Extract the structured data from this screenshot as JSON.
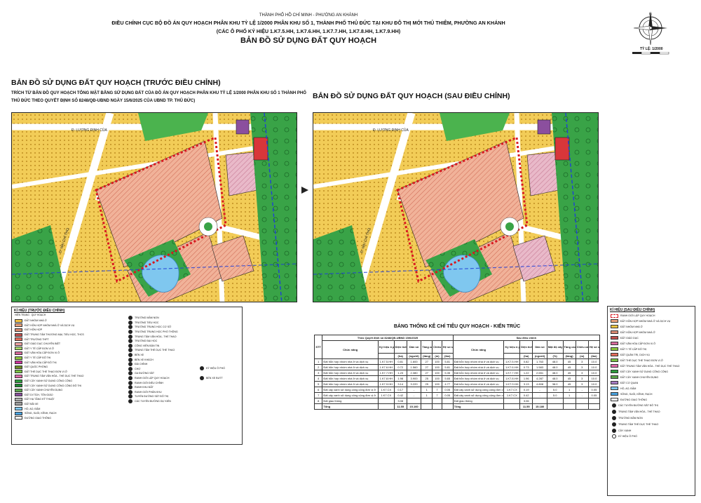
{
  "header": {
    "authority": "THÀNH PHỐ HỒ CHÍ MINH - PHƯỜNG AN KHÁNH",
    "line1": "ĐIỀU CHỈNH CỤC BỘ ĐỒ ÁN QUY HOẠCH PHÂN KHU TỶ LỆ 1/2000 PHÂN KHU SỐ 1, THÀNH PHỐ THỦ ĐỨC TẠI KHU ĐÔ THỊ MỚI THỦ THIÊM, PHƯỜNG AN KHÁNH",
    "line2": "(CÁC Ô PHỐ KÝ HIỆU 1.K7.5.HH, 1.K7.6.HH, 1.K7.7.HH, 1.K7.8.HH, 1.K7.9.HH)",
    "main_title": "BẢN ĐỒ SỬ DỤNG ĐẤT QUY HOẠCH"
  },
  "scale": {
    "label": "TỶ LỆ: 1/2000"
  },
  "left_panel": {
    "title": "BẢN ĐỒ SỬ DỤNG ĐẤT QUY HOẠCH (TRƯỚC ĐIỀU CHỈNH)",
    "subtitle1": "TRÍCH TỪ BẢN ĐỒ QUY HOẠCH TỔNG MẶT BẰNG SỬ DỤNG ĐẤT CỦA ĐỒ ÁN QUY HOẠCH PHÂN KHU TỶ LỆ 1/2000 PHÂN KHU SỐ 1 THÀNH PHỐ",
    "subtitle2": "THỦ ĐỨC THEO QUYẾT ĐỊNH SỐ 8248/QĐ-UBND NGÀY 15/6/2025 CỦA UBND TP. THỦ ĐỨC)"
  },
  "right_panel": {
    "title": "BẢN ĐỒ SỬ DỤNG ĐẤT QUY HOẠCH (SAU ĐIỀU CHỈNH)"
  },
  "legend_left": {
    "title": "KÍ HIỆU (TRƯỚC ĐIỀU CHỈNH)",
    "header_a": "HIỆN TRẠNG",
    "header_b": "QUY HOẠCH",
    "col1": [
      {
        "label": "ĐẤT NHÓM NHÀ Ở",
        "color": "#f4c542"
      },
      {
        "label": "ĐẤT HỖN HỢP NHÓM NHÀ Ở VÀ DỊCH VỤ",
        "color": "#e8a07c"
      },
      {
        "label": "ĐẤT HỖN HỢP",
        "color": "#d98a72"
      },
      {
        "label": "ĐẤT TRUNG TÂM THƯƠNG MẠI, TIỂU HỌC, THCS",
        "color": "#c0504d"
      },
      {
        "label": "ĐẤT TRƯỜNG THPT",
        "color": "#e46c5b"
      },
      {
        "label": "ĐẤT GIÁO DỤC CHUYÊN BIỆT",
        "color": "#f2a2a2"
      },
      {
        "label": "ĐẤT Y TẾ CẤP ĐƠN VỊ Ở",
        "color": "#a5d66a"
      },
      {
        "label": "ĐẤT VĂN HÓA CẤP ĐƠN VỊ Ở",
        "color": "#d86a9c"
      },
      {
        "label": "ĐẤT Y TẾ CẤP ĐÔ THỊ",
        "color": "#8cc63f"
      },
      {
        "label": "ĐẤT VĂN HÓA CẤP ĐÔ THỊ",
        "color": "#cc3399"
      },
      {
        "label": "ĐẤT QUỐC PHÒNG",
        "color": "#6b8e23"
      },
      {
        "label": "ĐẤT THỂ DỤC THỂ THAO ĐƠN VỊ Ở",
        "color": "#7ac143"
      },
      {
        "label": "ĐẤT TRUNG TÂM VĂN HÓA - THỂ DỤC THỂ THAO",
        "color": "#e26aa8"
      },
      {
        "label": "ĐẤT CÂY XANH SỬ DỤNG CÔNG CỘNG",
        "color": "#2e9e3e"
      },
      {
        "label": "ĐẤT CÂY XANH SỬ DỤNG CÔNG CỘNG ĐÔ THỊ",
        "color": "#1e8a32"
      },
      {
        "label": "ĐẤT CÂY XANH CHUYÊN DỤNG",
        "color": "#5aa64a"
      },
      {
        "label": "ĐẤT DI TÍCH, TÔN GIÁO",
        "color": "#8b4f9e"
      },
      {
        "label": "ĐẤT HẠ TẦNG KỸ THUẬT",
        "color": "#b0b0b0"
      },
      {
        "label": "ĐẤT BÃI XE",
        "color": "#9e9e9e"
      },
      {
        "label": "HỒ, AO, ĐẦM",
        "color": "#7fc7ef"
      },
      {
        "label": "SÔNG, SUỐI, KÊNH, RẠCH",
        "color": "#4aa3df"
      },
      {
        "label": "ĐƯỜNG GIAO THÔNG",
        "color": "#ffffff"
      }
    ],
    "col2": [
      "TRƯỜNG MẦM NON",
      "TRƯỜNG TIỂU HỌC",
      "TRƯỜNG TRUNG HỌC CƠ SỞ",
      "TRƯỜNG TRUNG HỌC PHỔ THÔNG",
      "TRUNG TÂM VĂN HÓA - THỂ THAO",
      "TRƯỜNG ĐẠI HỌC",
      "CÔNG VIÊN BẢN TIN",
      "TRUNG TÂM THỂ DỤC THỂ THAO",
      "BẾN XE",
      "BẾN XE KHÁCH",
      "ĐÀI CHỈNH",
      "CHỢ",
      "GA ĐƯỜNG SẮT",
      "RANH GIỚI LẬP QUY HOẠCH",
      "RANH GIỚI ĐIỀU CHỈNH",
      "RANH KHU ĐẤT",
      "RANH GIỚI PHÂN KHU",
      "TUYẾN ĐƯỜNG SẮT ĐÔ THỊ",
      "CÁC TUYẾN ĐƯỜNG DỰ KIẾN"
    ],
    "col3": [
      "KÝ HIỆU Ô PHỐ",
      "BẾN XE BUÝT"
    ]
  },
  "table": {
    "title": "BẢNG THỐNG KÊ CHỈ TIÊU QUY HOẠCH - KIẾN TRÚC",
    "group_before": "Theo Quyết định số 8248/QĐ-UBND 15/6/2025",
    "group_after": "Sau điều chỉnh",
    "headers": {
      "stt": "STT",
      "name": "Chức năng",
      "code": "Ký hiệu ô phố",
      "area": "Diện tích",
      "pop": "Dân số",
      "floors": "Tầng cao tối đa",
      "height": "Chiều cao",
      "far": "Hệ số sử dụng đất",
      "density": "Mật độ xây dựng tối đa",
      "unit_area": "(ha)",
      "unit_pop": "(người)",
      "unit_floor": "(tầng)",
      "unit_h": "(m)",
      "unit_pct": "(%)",
      "unit_far": "(lần)"
    },
    "rows": [
      {
        "stt": "1",
        "name": "Đất hỗn hợp nhóm nhà ở và dịch vụ",
        "code_b": "1.K7.5.HH",
        "area_b": "0.81",
        "pop_b": "1.600",
        "fl_b": "27",
        "h_b": "100",
        "far_b": "5.81",
        "name_a": "Đất hỗn hợp nhóm nhà ở và dịch vụ",
        "code_a": "1.K7.5.HH",
        "area_a": "0.82",
        "pop_a": "1.763",
        "den_a": "48.0",
        "fl_a": "45",
        "fl2_a": "3",
        "far_a": "10.0"
      },
      {
        "stt": "2",
        "name": "Đất hỗn hợp nhóm nhà ở và dịch vụ",
        "code_b": "1.K7.6.HH",
        "area_b": "0.72",
        "pop_b": "1.560",
        "fl_b": "27",
        "h_b": "100",
        "far_b": "5.81",
        "name_a": "Đất hỗn hợp nhóm nhà ở và dịch vụ",
        "code_a": "1.K7.6.HH",
        "area_a": "0.73",
        "pop_a": "1.583",
        "den_a": "48.0",
        "fl_a": "45",
        "fl2_a": "3",
        "far_a": "10.0"
      },
      {
        "stt": "3",
        "name": "Đất hỗn hợp nhóm nhà ở và dịch vụ",
        "code_b": "1.K7.7.HH",
        "area_b": "1.23",
        "pop_b": "2.380",
        "fl_b": "27",
        "h_b": "100",
        "far_b": "5.35",
        "name_a": "Đất hỗn hợp nhóm nhà ở và dịch vụ",
        "code_a": "1.K7.7.HH",
        "area_a": "1.22",
        "pop_a": "2.651",
        "den_a": "48.0",
        "fl_a": "45",
        "fl2_a": "3",
        "far_a": "10.0"
      },
      {
        "stt": "4",
        "name": "Đất hỗn hợp nhóm nhà ở và dịch vụ",
        "code_b": "1.K7.8.HH",
        "area_b": "1.98",
        "pop_b": "3.900",
        "fl_b": "25",
        "h_b": "100",
        "far_b": "5.65",
        "name_a": "Đất hỗn hợp nhóm nhà ở và dịch vụ",
        "code_a": "1.K7.8.HH",
        "area_a": "1.96",
        "pop_a": "4.287",
        "den_a": "48.0",
        "fl_a": "45",
        "fl2_a": "3",
        "far_a": "10.0"
      },
      {
        "stt": "5",
        "name": "Đất hỗn hợp nhóm nhà ở và dịch vụ",
        "code_b": "1.K7.9.HH",
        "area_b": "3.14",
        "pop_b": "3.220",
        "fl_b": "25",
        "h_b": "100",
        "far_b": "4.77",
        "name_a": "Đất hỗn hợp nhóm nhà ở và dịch vụ",
        "code_a": "1.K7.9.HH",
        "area_a": "3.13",
        "pop_a": "4.808",
        "den_a": "38.0",
        "fl_a": "45",
        "fl2_a": "3",
        "far_a": "10.0"
      },
      {
        "stt": "6",
        "name": "Đất cây xanh sử dụng công cộng đơn vị ở",
        "code_b": "1.K7.CX",
        "area_b": "0.17",
        "pop_b": "-",
        "fl_b": "1",
        "h_b": "7",
        "far_b": "0.05",
        "name_a": "Đất cây xanh sử dụng công cộng đơn vị ở",
        "code_a": "1.K7.CX",
        "area_a": "0.19",
        "pop_a": "-",
        "den_a": "5.0",
        "fl_a": "1",
        "fl2_a": "-",
        "far_a": "0.05"
      },
      {
        "stt": "7",
        "name": "Đất cây xanh sử dụng công cộng đơn vị ở",
        "code_b": "1.K7.CX",
        "area_b": "0.42",
        "pop_b": "-",
        "fl_b": "1",
        "h_b": "7",
        "far_b": "0.05",
        "name_a": "Đất cây xanh sử dụng công cộng đơn vị ở",
        "code_a": "1.K7.CX",
        "area_a": "0.42",
        "pop_a": "-",
        "den_a": "5.0",
        "fl_a": "1",
        "fl2_a": "-",
        "far_a": "0.05"
      },
      {
        "stt": "8",
        "name": "Đất giao thông",
        "code_b": "",
        "area_b": "3.08",
        "pop_b": "",
        "fl_b": "",
        "h_b": "",
        "far_b": "",
        "name_a": "Đất giao thông",
        "code_a": "",
        "area_a": "3.06",
        "pop_a": "",
        "den_a": "",
        "fl_a": "",
        "fl2_a": "",
        "far_a": ""
      }
    ],
    "total": {
      "label": "Tổng",
      "area_b": "11.55",
      "pop_b": "15.160",
      "label_a": "Tổng",
      "area_a": "11.55",
      "pop_a": "15.180"
    }
  },
  "legend_right": {
    "title": "KÍ HIỆU (SAU ĐIỀU CHỈNH)",
    "top_label": "RANH GIỚI LẬP QUY HOẠCH",
    "items": [
      {
        "label": "ĐẤT HỖN HỢP NHÓM NHÀ Ở VÀ DỊCH VỤ",
        "color": "#e8a07c"
      },
      {
        "label": "ĐẤT NHÓM NHÀ Ở",
        "color": "#f4c542"
      },
      {
        "label": "ĐẤT HỖN HỢP NHÓM NHÀ Ở",
        "color": "#d98a72"
      },
      {
        "label": "ĐẤT GIÁO DỤC",
        "color": "#c0504d"
      },
      {
        "label": "ĐẤT VĂN HÓA CẤP ĐƠN VỊ Ở",
        "color": "#d86a9c"
      },
      {
        "label": "ĐẤT Y TẾ CẤP ĐÔ THỊ",
        "color": "#8cc63f"
      },
      {
        "label": "ĐẤT QUẢN TRỊ, DỊCH VỤ",
        "color": "#e46c5b"
      },
      {
        "label": "ĐẤT THỂ DỤC THỂ THAO ĐƠN VỊ Ở",
        "color": "#7ac143"
      },
      {
        "label": "ĐẤT TRUNG TÂM VĂN HÓA - THỂ DỤC THỂ THAO",
        "color": "#e26aa8"
      },
      {
        "label": "ĐẤT CÂY XANH SỬ DỤNG CÔNG CỘNG",
        "color": "#2e9e3e"
      },
      {
        "label": "ĐẤT CÂY XANH CHUYÊN DỤNG",
        "color": "#5aa64a"
      },
      {
        "label": "ĐẤT CƠ QUAN",
        "color": "#a57bc2"
      },
      {
        "label": "HỒ, AO, ĐẦM",
        "color": "#7fc7ef"
      },
      {
        "label": "SÔNG, SUỐI, KÊNH, RẠCH",
        "color": "#4aa3df"
      },
      {
        "label": "ĐƯỜNG GIAO THÔNG",
        "color": "#ffffff"
      }
    ],
    "symbols": [
      "CÁC TUYẾN ĐƯỜNG SẮT ĐÔ THỊ",
      "TRUNG TÂM VĂN HÓA - THỂ THAO",
      "TRƯỜNG MẦM NON",
      "TRUNG TÂM THỂ DỤC THỂ THAO",
      "CÂY XANH"
    ],
    "code_label": "KÝ HIỆU Ô PHỐ"
  },
  "map_labels": {
    "road1": "Đ. LƯƠNG ĐỊNH CỦA",
    "road2": "Đ. MAI CHÍ THỌ",
    "road3": "Đ. B3"
  }
}
